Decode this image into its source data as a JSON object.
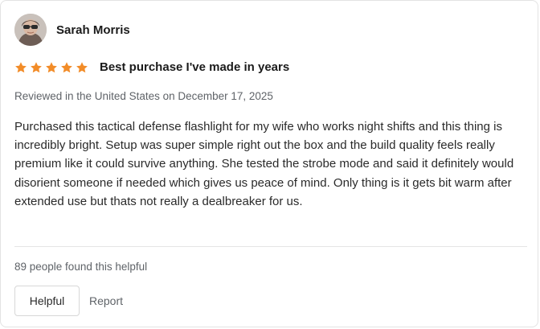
{
  "reviewer": {
    "name": "Sarah Morris",
    "avatar_icon": "user-avatar-photo"
  },
  "rating": {
    "stars": 5,
    "max_stars": 5,
    "star_color": "#f28c28"
  },
  "review": {
    "title": "Best purchase I've made in years",
    "meta": "Reviewed in the United States on December 17, 2025",
    "body": "Purchased this tactical defense flashlight for my wife who works night shifts and this thing is incredibly bright. Setup was super simple right out the box and the build quality feels really premium like it could survive anything. She tested the strobe mode and said it definitely would disorient someone if needed which gives us peace of mind. Only thing is it gets bit warm after extended use but thats not really a dealbreaker for us."
  },
  "feedback": {
    "helpful_count_text": "89 people found this helpful",
    "helpful_label": "Helpful",
    "report_label": "Report"
  }
}
